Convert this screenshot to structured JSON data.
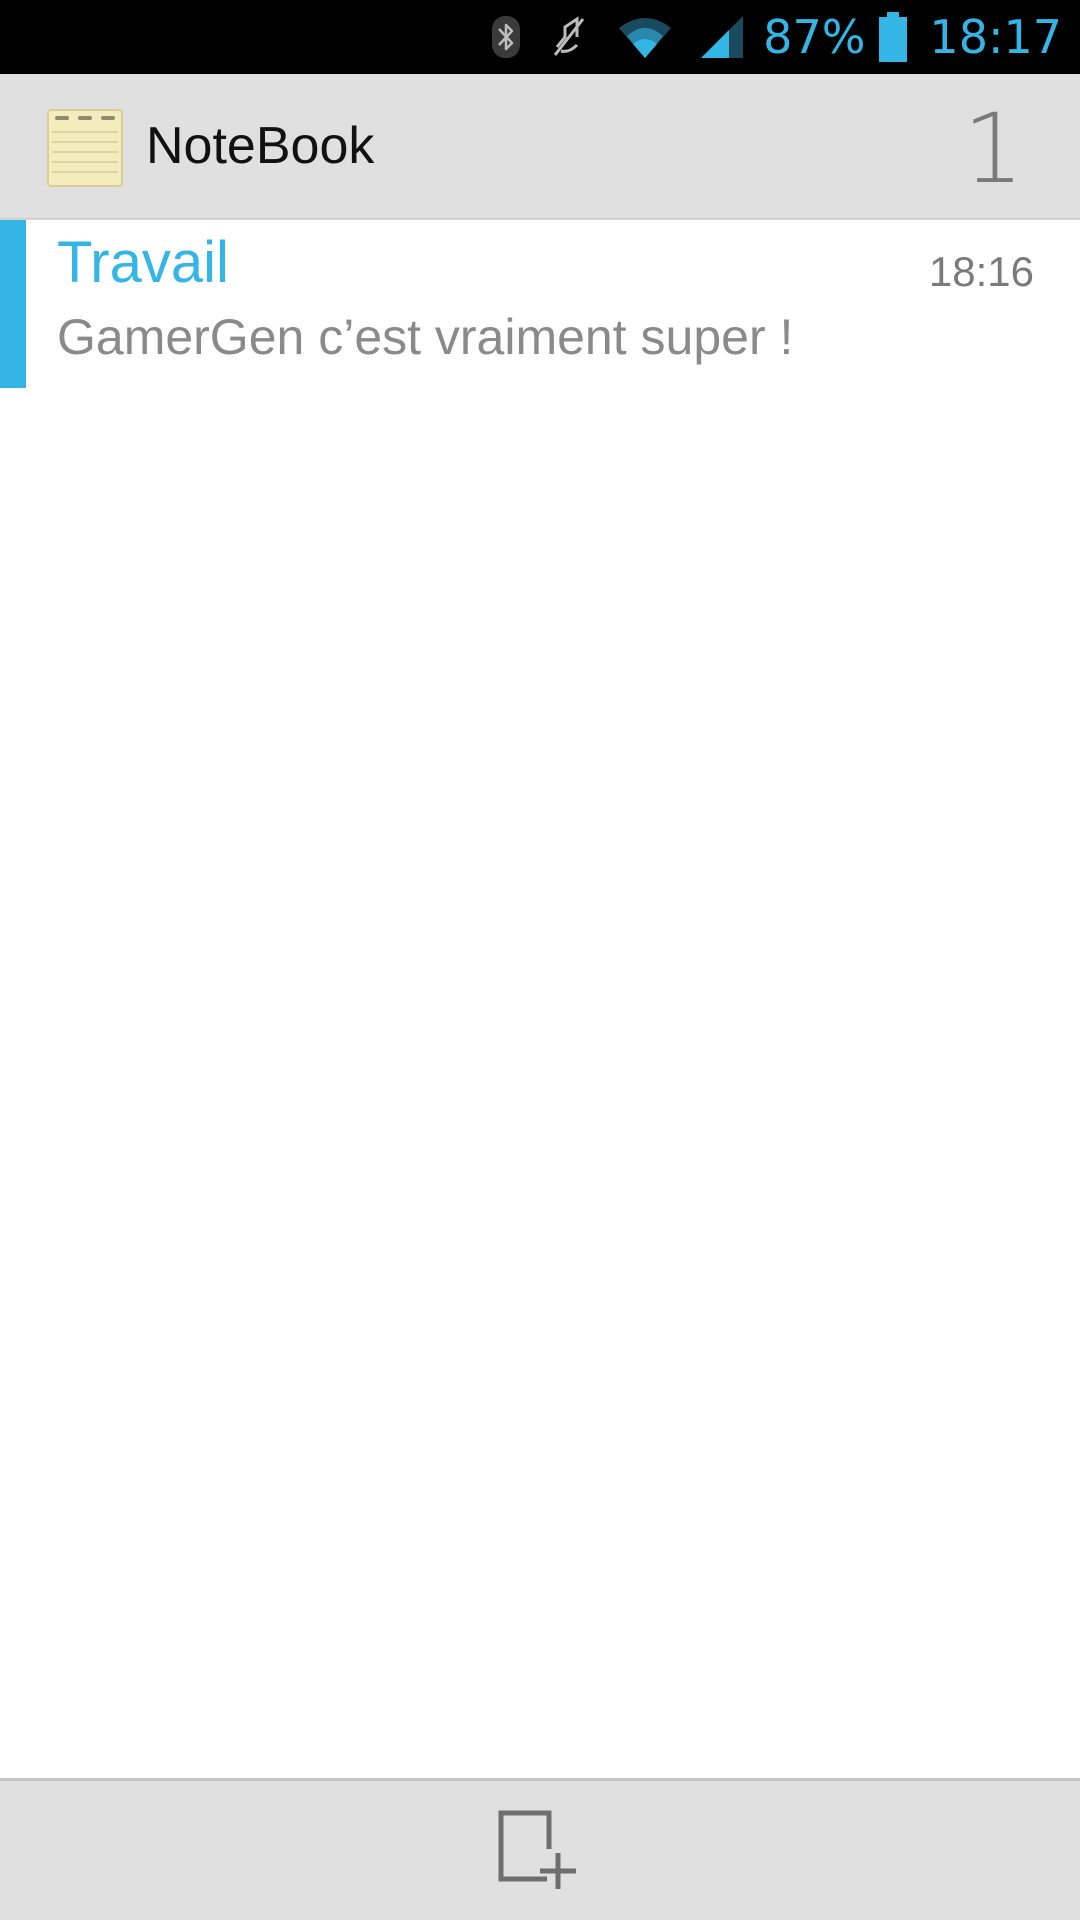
{
  "status_bar": {
    "battery_percent": "87%",
    "clock": "18:17",
    "icons": [
      "bluetooth-icon",
      "mute-icon",
      "wifi-icon",
      "signal-icon",
      "battery-icon"
    ],
    "accent_color": "#33b5e5"
  },
  "action_bar": {
    "title": "NoteBook",
    "note_count": "1",
    "icon": "notepad-icon"
  },
  "notes": [
    {
      "title": "Travail",
      "time": "18:16",
      "preview": "GamerGen c’est vraiment super !",
      "accent_color": "#33b5e5"
    }
  ],
  "bottom_bar": {
    "add_icon": "add-note-icon"
  }
}
